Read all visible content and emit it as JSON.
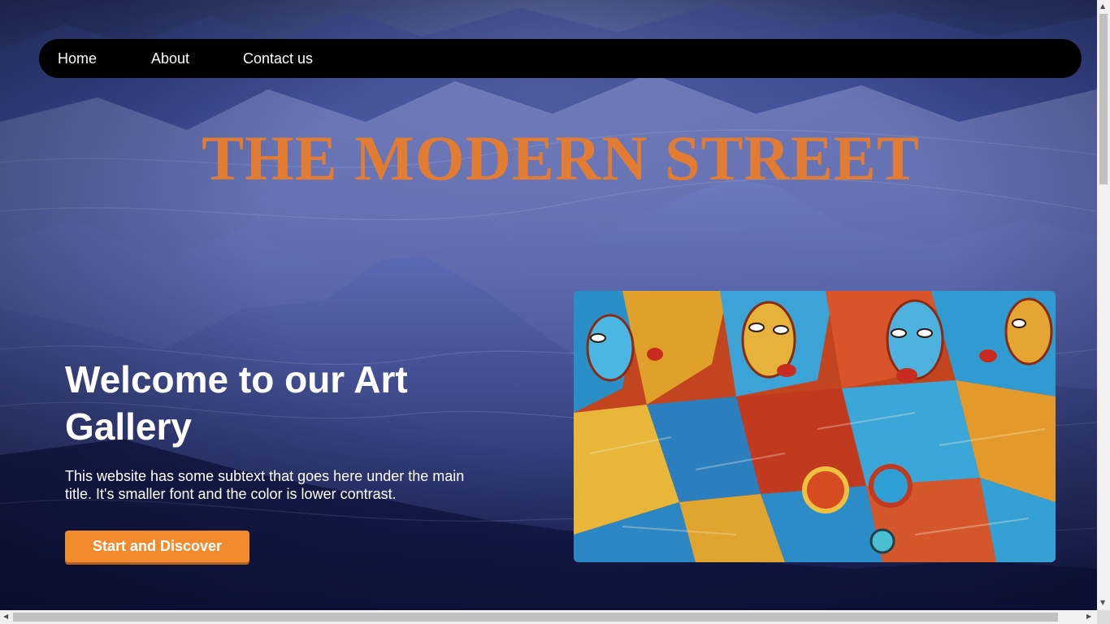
{
  "nav": {
    "items": [
      {
        "label": "Home"
      },
      {
        "label": "About"
      },
      {
        "label": "Contact us"
      }
    ]
  },
  "site": {
    "title": "THE MODERN STREET"
  },
  "hero": {
    "heading": "Welcome to our Art Gallery",
    "subtext": "This website has some subtext that goes here under the main title. It's smaller font and the color is lower contrast.",
    "cta_label": "Start and Discover"
  },
  "colors": {
    "title": "#e27c33",
    "cta": "#f28a2e",
    "nav_bg": "#000000"
  },
  "icons": {
    "scroll_up": "arrow-up-icon",
    "scroll_down": "arrow-down-icon",
    "scroll_left": "arrow-left-icon",
    "scroll_right": "arrow-right-icon"
  }
}
